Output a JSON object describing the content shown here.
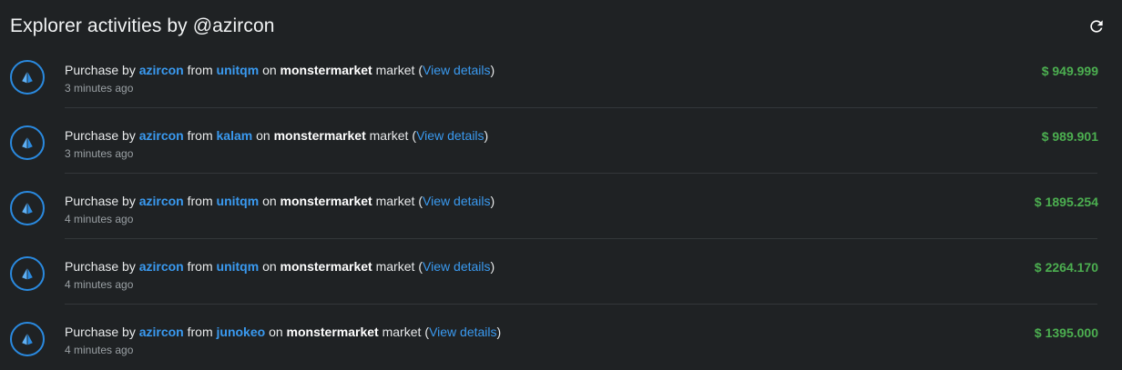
{
  "header": {
    "title": "Explorer activities by @azircon",
    "refresh_icon": "refresh-icon"
  },
  "labels": {
    "purchase_by": "Purchase by",
    "from": "from",
    "on": "on",
    "market": "market",
    "open_paren": "(",
    "close_paren": ")",
    "view_details": "View details"
  },
  "colors": {
    "link": "#3a9af0",
    "amount": "#4caf50",
    "avatar_border": "#2a8ae0"
  },
  "activities": [
    {
      "buyer": "azircon",
      "seller": "unitqm",
      "market": "monstermarket",
      "time": "3 minutes ago",
      "amount": "$ 949.999",
      "icon": "pyramid-icon"
    },
    {
      "buyer": "azircon",
      "seller": "kalam",
      "market": "monstermarket",
      "time": "3 minutes ago",
      "amount": "$ 989.901",
      "icon": "pyramid-icon"
    },
    {
      "buyer": "azircon",
      "seller": "unitqm",
      "market": "monstermarket",
      "time": "4 minutes ago",
      "amount": "$ 1895.254",
      "icon": "pyramid-icon"
    },
    {
      "buyer": "azircon",
      "seller": "unitqm",
      "market": "monstermarket",
      "time": "4 minutes ago",
      "amount": "$ 2264.170",
      "icon": "pyramid-icon"
    },
    {
      "buyer": "azircon",
      "seller": "junokeo",
      "market": "monstermarket",
      "time": "4 minutes ago",
      "amount": "$ 1395.000",
      "icon": "pyramid-icon"
    }
  ]
}
